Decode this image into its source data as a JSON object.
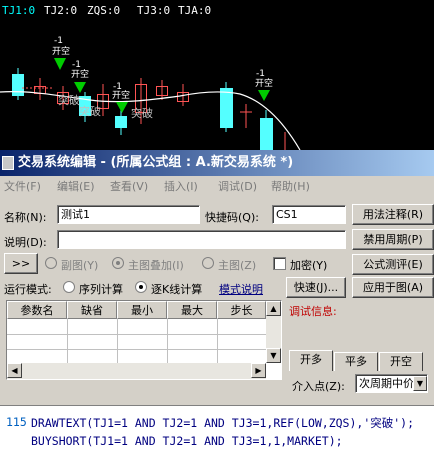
{
  "chart": {
    "header": {
      "tj1": "TJ1:0",
      "tj2": "TJ2:0",
      "zqs": "ZQS:0",
      "tj3": "TJ3:0",
      "tja": "TJA:0"
    },
    "signals": [
      {
        "minus": "-1",
        "label": "开空"
      },
      {
        "minus": "-1",
        "label": "开空"
      },
      {
        "minus": "-1",
        "label": "开空"
      },
      {
        "minus": "-1",
        "label": "开空"
      }
    ],
    "breakthrough_labels": [
      "突破",
      "突破",
      "突破"
    ],
    "colors": {
      "up": "#ff5454",
      "down": "#54ffff",
      "ma": "#ffffff",
      "signal": "#00cc00",
      "bg": "#000000"
    }
  },
  "dialog": {
    "title": "交易系统编辑 - (所属公式组 : A.新交易系统 *)",
    "menu": [
      "文件(F)",
      "编辑(E)",
      "查看(V)",
      "插入(I)",
      "调试(D)",
      "帮助(H)"
    ],
    "name_label": "名称(N):",
    "name_value": "测试1",
    "shortcut_label": "快捷码(Q):",
    "shortcut_value": "CS1",
    "desc_label": "说明(D):",
    "desc_value": "",
    "btn_usage": "用法注释(R)",
    "btn_disable_period": "禁用周期(P)",
    "btn_formula_test": "公式测评(E)",
    "btn_apply": "应用于图(A)",
    "arrow_btn": ">>",
    "radio_subchart": "副图(Y)",
    "radio_main_overlay": "主图叠加(I)",
    "radio_main": "主图(Z)",
    "check_encrypt": "加密(Y)",
    "run_mode_label": "运行模式:",
    "run_seq": "序列计算",
    "run_stepwise": "逐K线计算",
    "mode_desc_link": "模式说明",
    "fast_btn": "快速(J)...",
    "table_headers": [
      "参数名",
      "缺省",
      "最小",
      "最大",
      "步长"
    ],
    "debug_info_label": "调试信息:",
    "tabs": [
      "开多",
      "平多",
      "开空"
    ],
    "entry_point_label": "介入点(Z):",
    "entry_point_value": "次周期中价"
  },
  "code": {
    "line_no": "115",
    "line1": "DRAWTEXT(TJ1=1 AND TJ2=1 AND TJ3=1,REF(LOW,ZQS),'突破');",
    "line2": "BUYSHORT(TJ1=1 AND TJ2=1 AND TJ3=1,1,MARKET);"
  }
}
